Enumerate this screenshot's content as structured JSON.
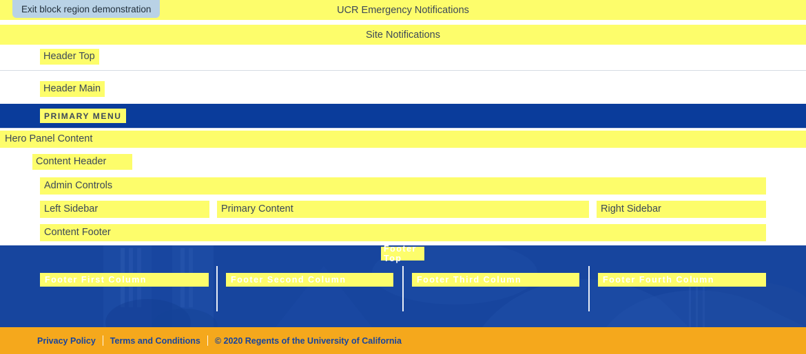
{
  "exit_button": {
    "label": "Exit block region demonstration"
  },
  "notifications": {
    "emergency": "UCR Emergency Notifications",
    "site": "Site Notifications"
  },
  "header": {
    "top": "Header Top",
    "main": "Header Main",
    "primary_menu": "PRIMARY MENU"
  },
  "hero": {
    "label": "Hero Panel Content"
  },
  "content": {
    "header": "Content Header",
    "admin_controls": "Admin Controls",
    "left_sidebar": "Left Sidebar",
    "primary_content": "Primary Content",
    "right_sidebar": "Right Sidebar",
    "footer": "Content Footer"
  },
  "footer": {
    "top": "Footer Top",
    "columns": [
      "Footer First Column",
      "Footer Second Column",
      "Footer Third Column",
      "Footer Fourth Column"
    ]
  },
  "legal": {
    "privacy": "Privacy Policy",
    "terms": "Terms and Conditions",
    "copyright": "© 2020 Regents of the University of California"
  },
  "colors": {
    "highlight_yellow": "#fdfd6b",
    "menu_blue": "#0a3c9b",
    "footer_blue": "#17459e",
    "legal_gold": "#f5a81c",
    "exit_button_blue": "#b9d2e6",
    "label_text": "#3c4858"
  }
}
